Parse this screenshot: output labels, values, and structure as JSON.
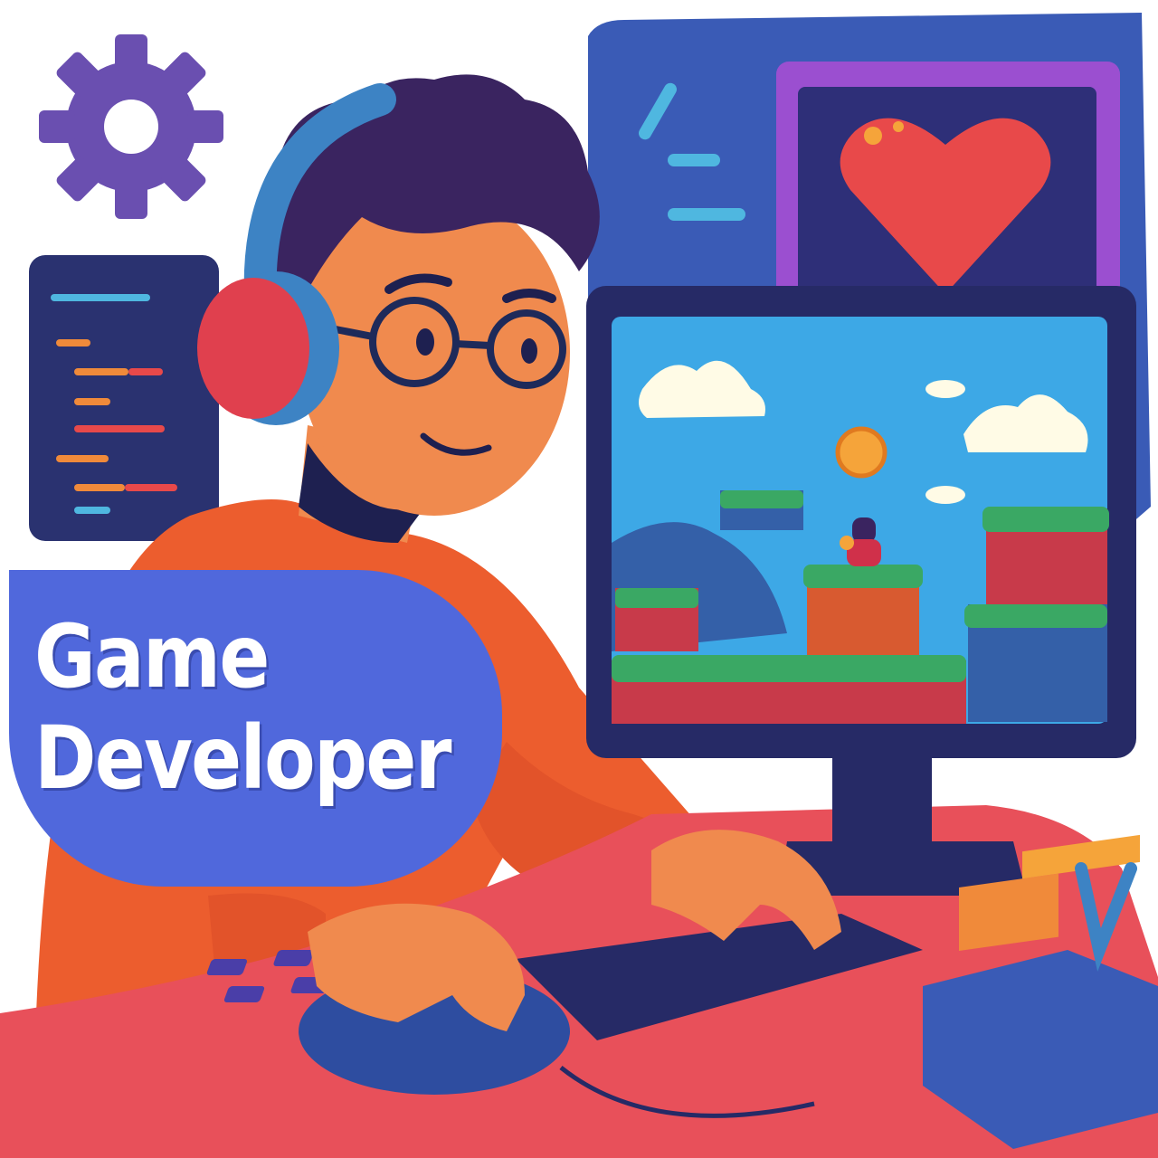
{
  "label": {
    "line1": "Game",
    "line2": "Developer"
  },
  "colors": {
    "badge": "#5068dc",
    "desk": "#e8505a",
    "sweater": "#ec5d2e",
    "monitor_frame": "#2a2f6e",
    "sky": "#3da8e6",
    "heart": "#e8494a",
    "gear": "#6a4fb0"
  },
  "icons": [
    "gear-icon",
    "heart-icon",
    "coin-icon",
    "headphones-icon"
  ]
}
